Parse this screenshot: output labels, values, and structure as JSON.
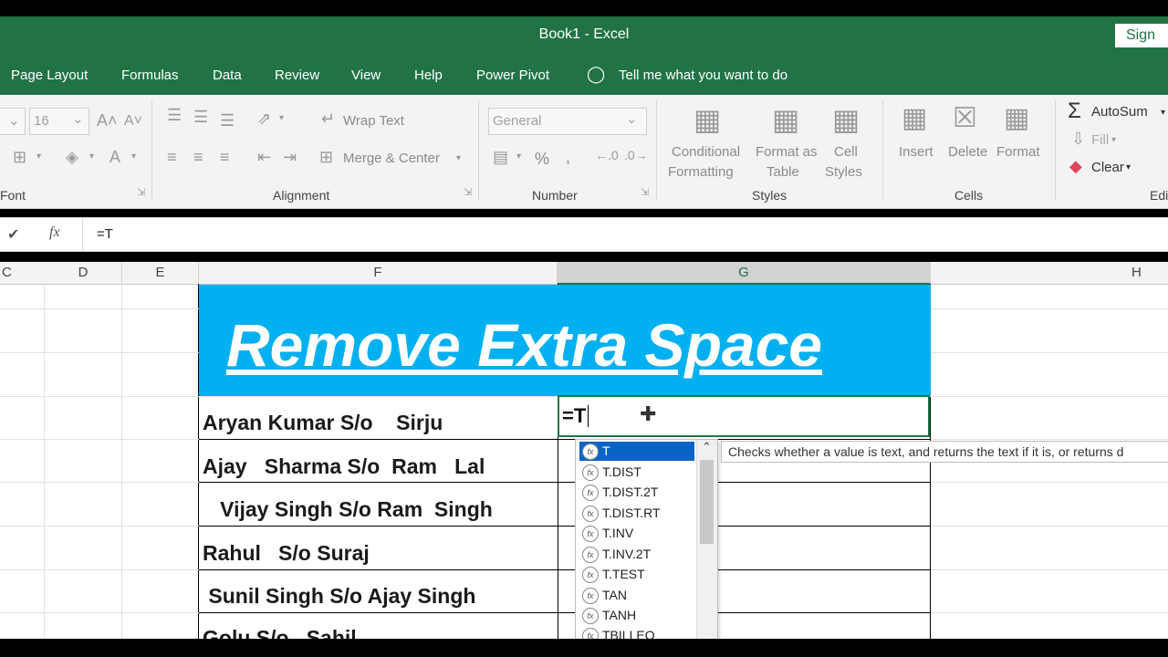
{
  "window": {
    "title": "Book1  -  Excel",
    "signin": "Sign"
  },
  "menu": [
    "Page Layout",
    "Formulas",
    "Data",
    "Review",
    "View",
    "Help",
    "Power Pivot",
    "Tell me what you want to do"
  ],
  "ribbon": {
    "font_size": "16",
    "wrap_text": "Wrap Text",
    "merge_center": "Merge & Center",
    "number_format": "General",
    "percent": "%",
    "comma": ",",
    "conditional_formatting": [
      "Conditional",
      "Formatting"
    ],
    "format_as_table": [
      "Format as",
      "Table"
    ],
    "cell_styles": [
      "Cell",
      "Styles"
    ],
    "insert": "Insert",
    "delete": "Delete",
    "format": "Format",
    "autosum": "AutoSum",
    "fill": "Fill",
    "clear": "Clear",
    "groups": {
      "font": "Font",
      "alignment": "Alignment",
      "number": "Number",
      "styles": "Styles",
      "cells": "Cells",
      "editing": "Edi"
    }
  },
  "formula_bar": {
    "value": "=T",
    "fx": "fx"
  },
  "columns": [
    "C",
    "D",
    "E",
    "F",
    "G",
    "H"
  ],
  "sheet": {
    "banner": "Remove Extra Space",
    "active_cell_value": "=T",
    "names": [
      "Aryan Kumar S/o    Sirju",
      "Ajay   Sharma S/o  Ram   Lal",
      "   Vijay Singh S/o Ram  Singh",
      "Rahul   S/o Suraj",
      " Sunil Singh S/o Ajay Singh",
      "Golu S/o   Sahil"
    ]
  },
  "autocomplete": {
    "items": [
      "T",
      "T.DIST",
      "T.DIST.2T",
      "T.DIST.RT",
      "T.INV",
      "T.INV.2T",
      "T.TEST",
      "TAN",
      "TANH",
      "TBILLEQ"
    ],
    "tooltip": "Checks whether a value is text, and returns the text if it is, or returns d"
  },
  "colors": {
    "excel_green": "#217346",
    "banner_blue": "#00b0f0",
    "selection_blue": "#0a64c8"
  }
}
